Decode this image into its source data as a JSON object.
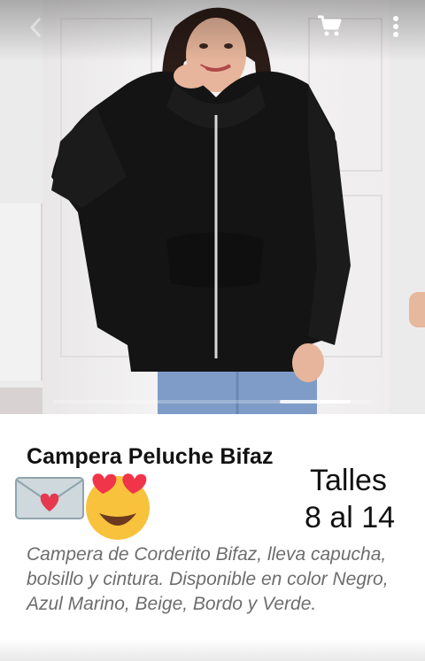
{
  "product": {
    "title": "Campera Peluche Bifaz",
    "sizes_line1": "Talles",
    "sizes_line2": "8 al 14",
    "description": "Campera de Corderito Bifaz, lleva capucha, bolsillo y cintura. Disponible en color Negro, Azul Marino, Beige, Bordo y Verde."
  },
  "icons": {
    "cart": "shopping-cart-icon",
    "more": "more-vertical-icon",
    "back": "chevron-left-icon",
    "emoji1": "love-letter-emoji",
    "emoji2": "heart-eyes-emoji"
  },
  "colors": {
    "title": "#111111",
    "description": "#6d6d6d",
    "jacket": "#141414"
  },
  "carousel": {
    "current_image": 2,
    "images_visible": 3
  }
}
